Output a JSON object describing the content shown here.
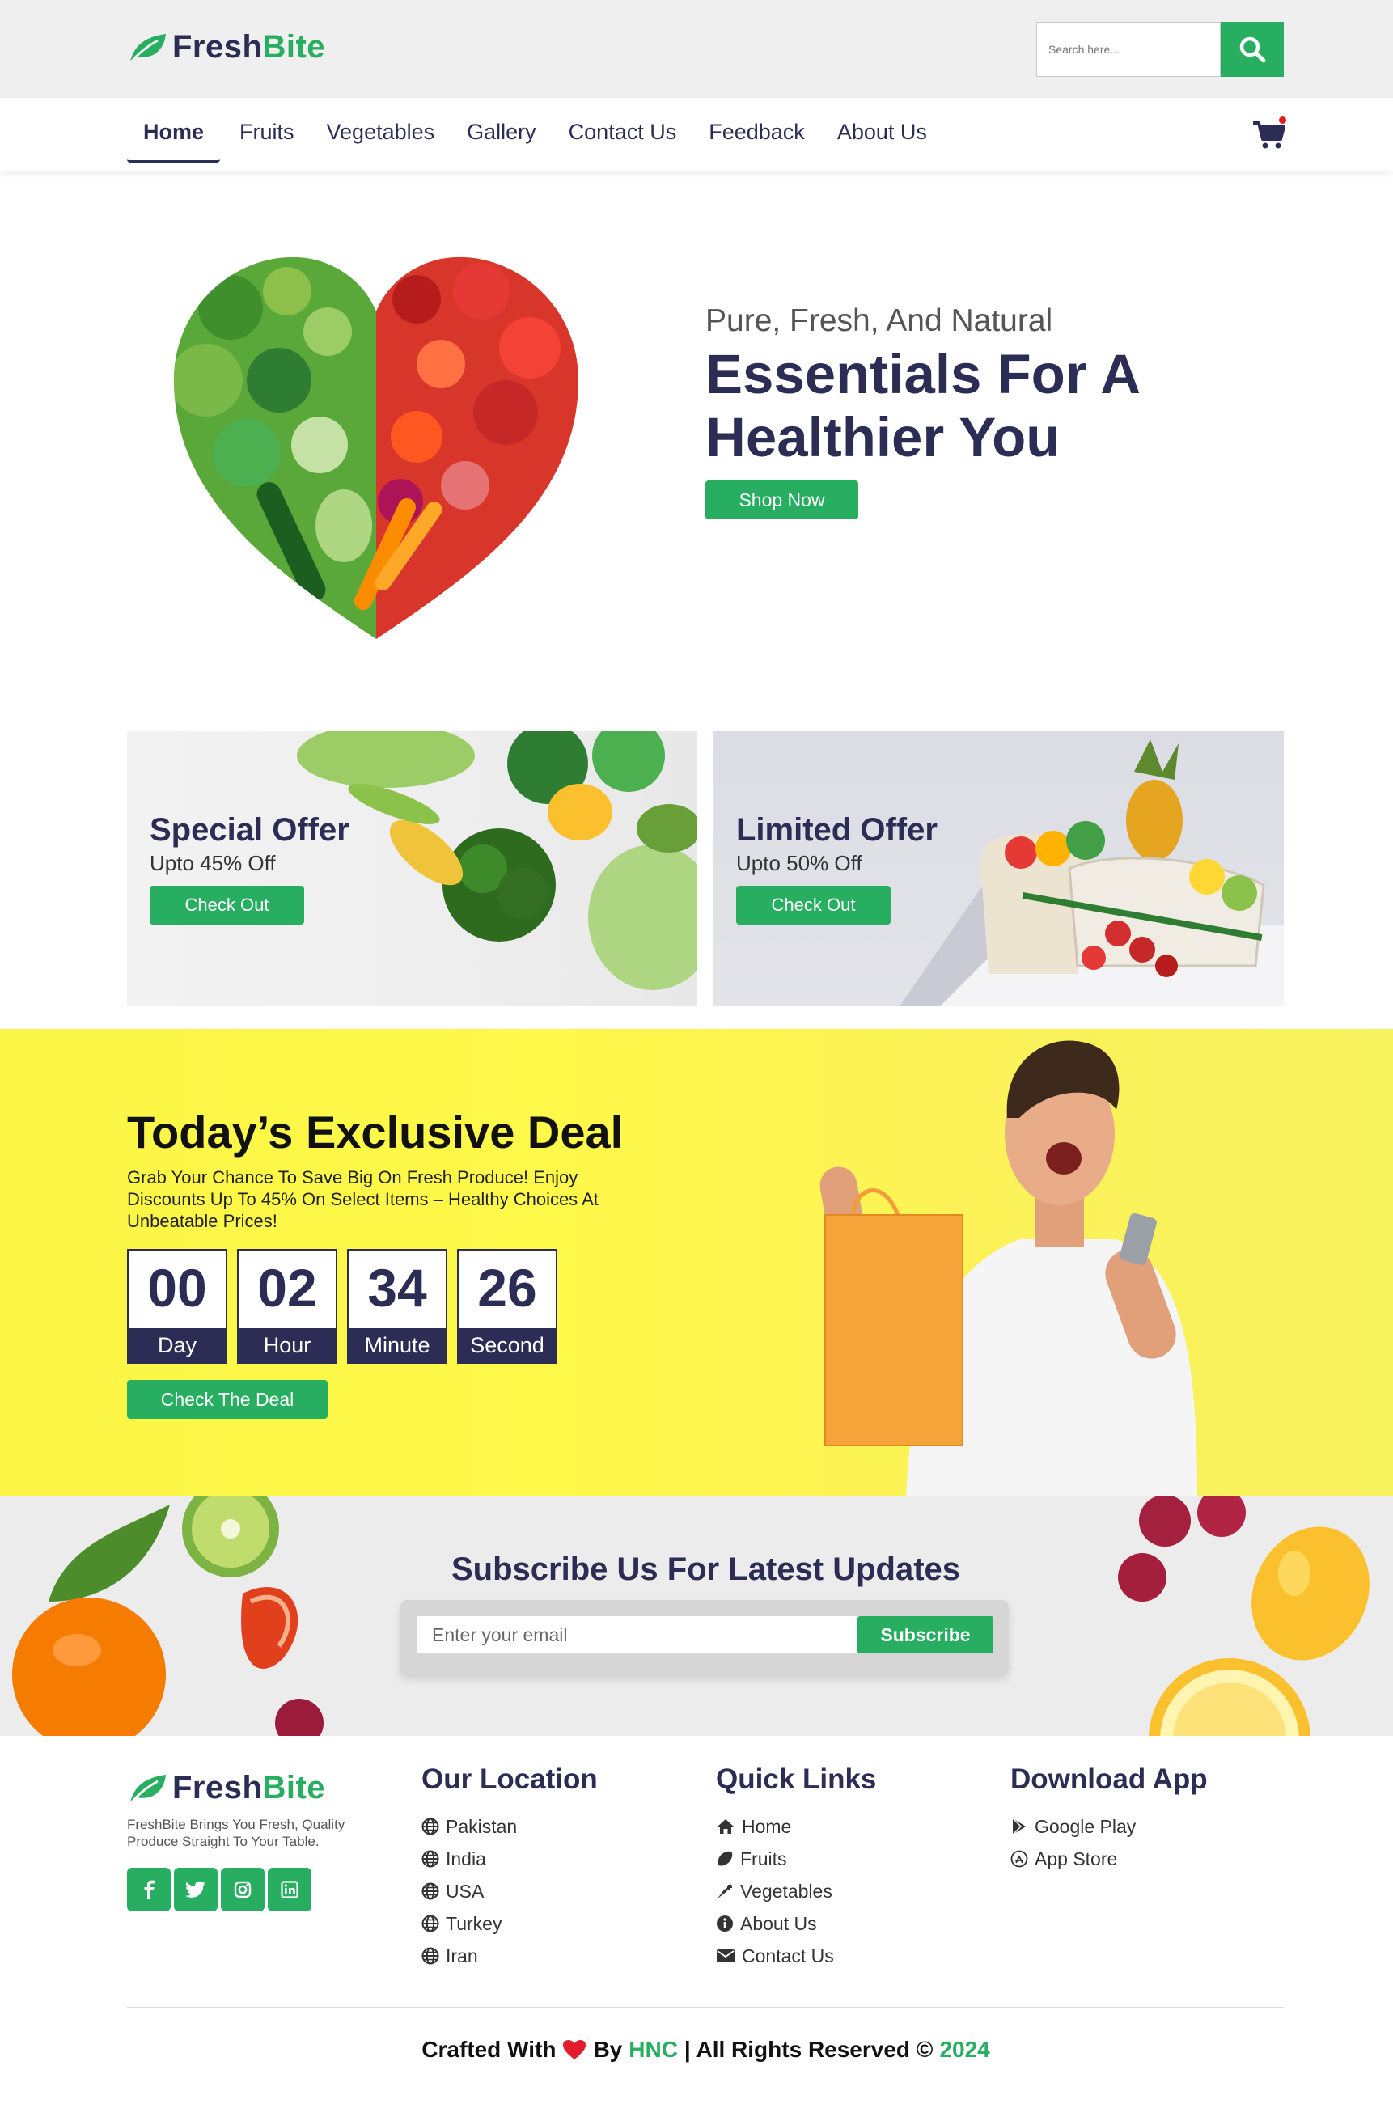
{
  "brand": {
    "part1": "Fresh",
    "part2": "Bite",
    "green": "#27ae60",
    "navy": "#2b2d55"
  },
  "search": {
    "placeholder": "Search here...",
    "icon": "search-icon"
  },
  "nav": {
    "items": [
      {
        "label": "Home",
        "active": true
      },
      {
        "label": "Fruits"
      },
      {
        "label": "Vegetables"
      },
      {
        "label": "Gallery"
      },
      {
        "label": "Contact Us"
      },
      {
        "label": "Feedback"
      },
      {
        "label": "About Us"
      }
    ],
    "cart_icon": "shopping-cart-icon"
  },
  "hero": {
    "subtitle": "Pure, Fresh, And Natural",
    "title": "Essentials For A Healthier You",
    "button": "Shop Now"
  },
  "offers": [
    {
      "title": "Special Offer",
      "subtitle": "Upto 45% Off",
      "button": "Check Out"
    },
    {
      "title": "Limited Offer",
      "subtitle": "Upto 50% Off",
      "button": "Check Out"
    }
  ],
  "deal": {
    "title": "Today’s Exclusive Deal",
    "text": "Grab Your Chance To Save Big On Fresh Produce! Enjoy Discounts Up To 45% On Select Items – Healthy Choices At Unbeatable Prices!",
    "countdown": [
      {
        "value": "00",
        "label": "Day"
      },
      {
        "value": "02",
        "label": "Hour"
      },
      {
        "value": "34",
        "label": "Minute"
      },
      {
        "value": "26",
        "label": "Second"
      }
    ],
    "button": "Check The Deal"
  },
  "subscribe": {
    "title": "Subscribe Us For Latest Updates",
    "placeholder": "Enter your email",
    "button": "Subscribe"
  },
  "footer": {
    "about": "FreshBite Brings You Fresh, Quality Produce Straight To Your Table.",
    "socials": [
      "facebook-icon",
      "twitter-icon",
      "instagram-icon",
      "linkedin-icon"
    ],
    "location": {
      "heading": "Our Location",
      "items": [
        "Pakistan",
        "India",
        "USA",
        "Turkey",
        "Iran"
      ]
    },
    "quick_links": {
      "heading": "Quick Links",
      "items": [
        "Home",
        "Fruits",
        "Vegetables",
        "About Us",
        "Contact Us"
      ]
    },
    "download": {
      "heading": "Download App",
      "items": [
        "Google Play",
        "App Store"
      ]
    },
    "copyright": {
      "crafted": "Crafted With",
      "by": "By",
      "author": "HNC",
      "rights": "| All Rights Reserved ©",
      "year": "2024"
    }
  }
}
